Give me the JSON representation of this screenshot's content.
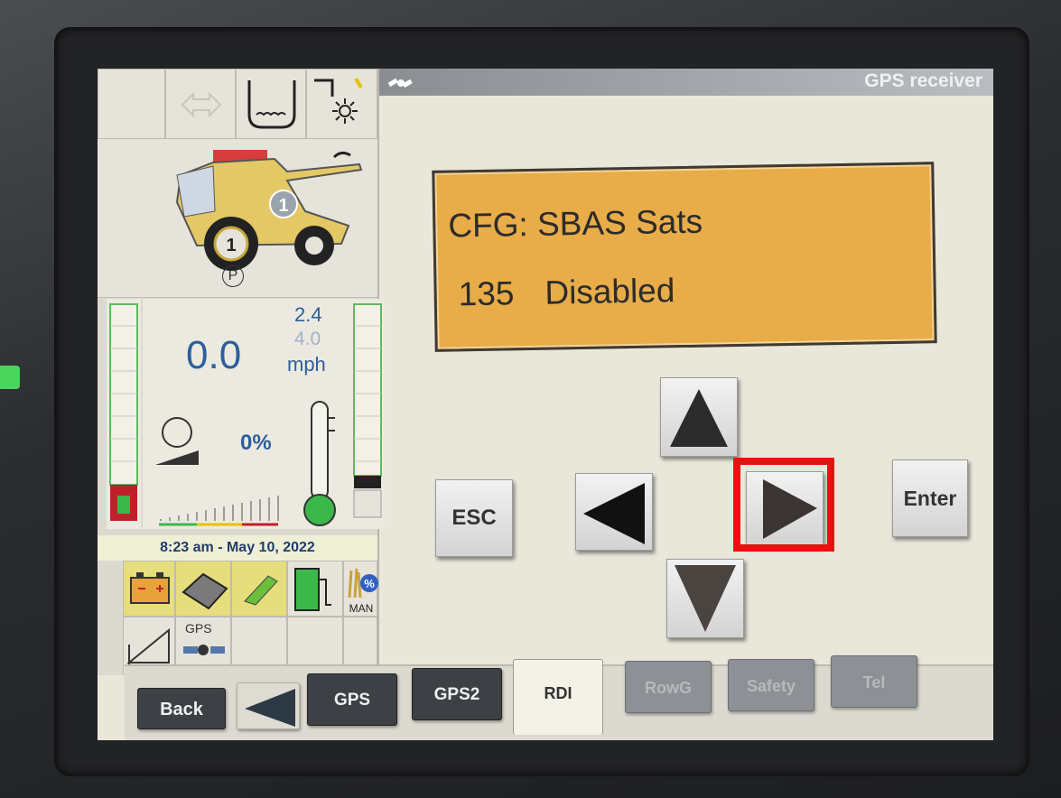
{
  "header": {
    "title": "GPS receiver",
    "icon": "satellite-icon"
  },
  "lcd": {
    "line1": "CFG: SBAS Sats",
    "value_number": "135",
    "value_text": "Disabled"
  },
  "keys": {
    "esc_label": "ESC",
    "enter_label": "Enter",
    "up_icon": "arrow-up-icon",
    "left_icon": "arrow-left-icon",
    "right_icon": "arrow-right-icon",
    "down_icon": "arrow-down-icon",
    "highlighted_key": "right"
  },
  "left_panel": {
    "park_indicator": "P",
    "combine_badge": "1",
    "speed": "0.0",
    "gear_value_1": "2.4",
    "gear_value_2": "4.0",
    "speed_unit": "mph",
    "engine_load": "0%",
    "datetime": "8:23 am - May 10, 2022",
    "gps_label": "GPS",
    "man_label": "MAN",
    "percent_label": "%"
  },
  "tabs": {
    "back": "Back",
    "gps": "GPS",
    "gps2": "GPS2",
    "rdi": "RDI",
    "rowg": "RowG",
    "safety": "Safety",
    "tel": "Tel",
    "active": "RDI"
  },
  "colors": {
    "lcd_background": "#e8ac49",
    "highlight_border": "#ee1010",
    "speed_text": "#2c5f9c",
    "tab_dark": "#3d4044"
  }
}
